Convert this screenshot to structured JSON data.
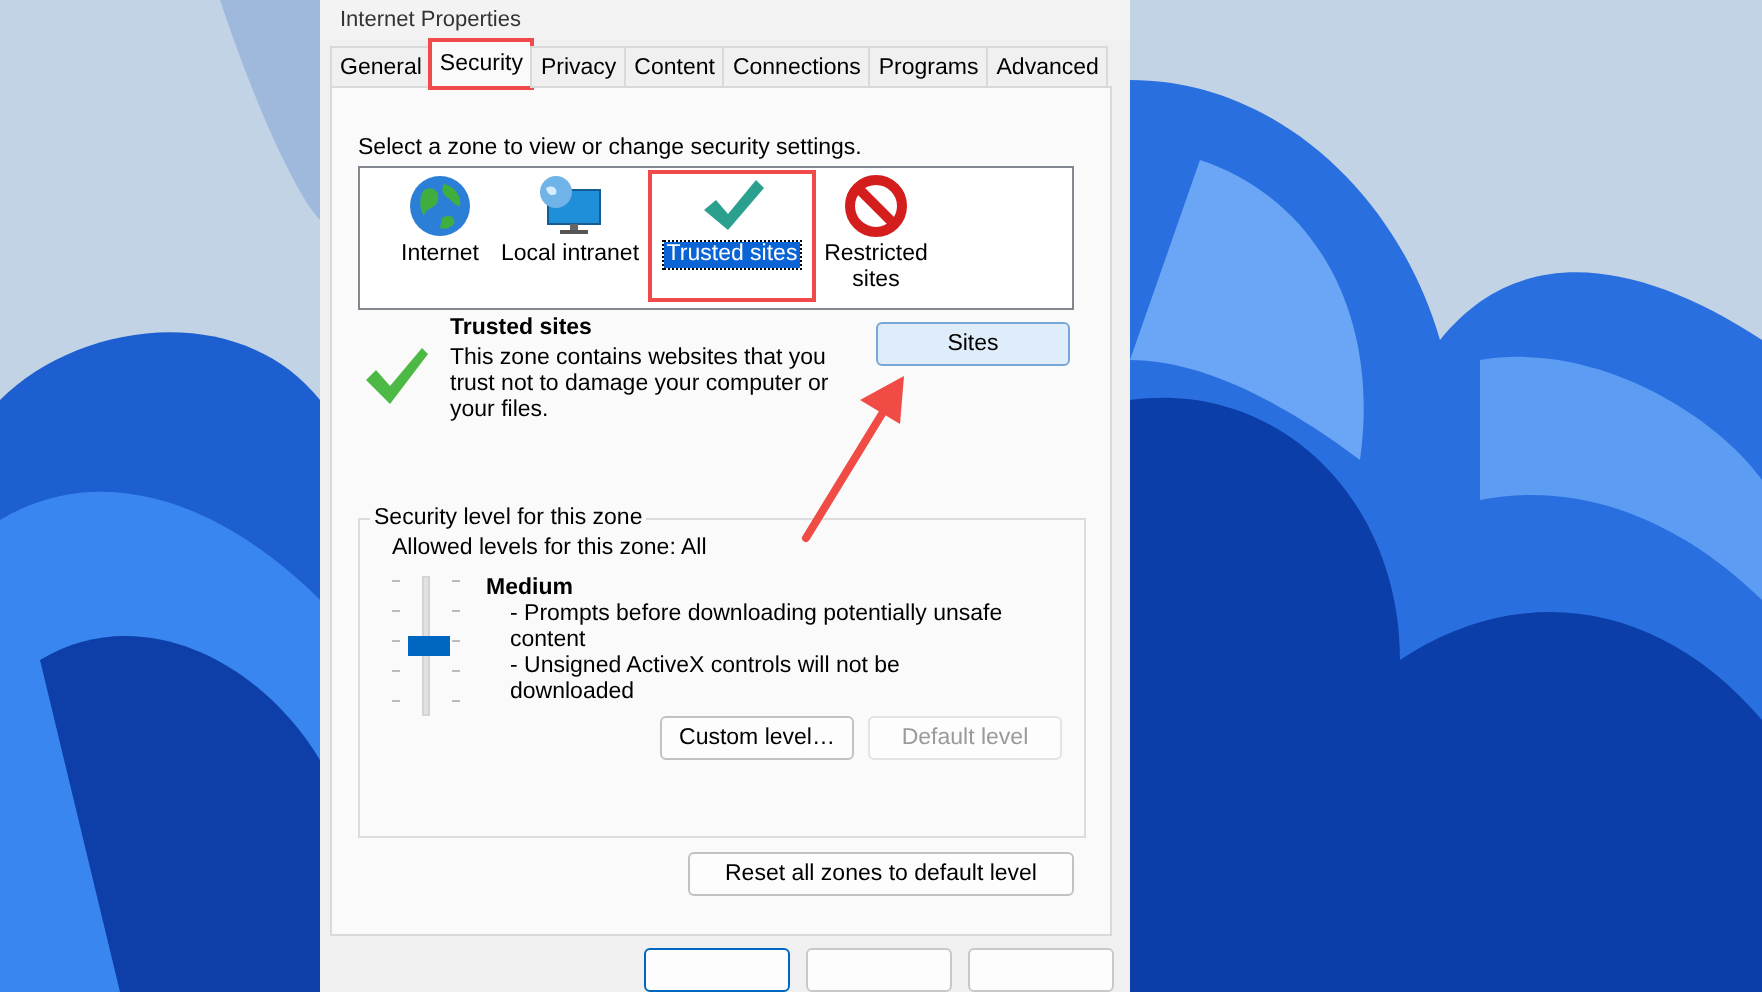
{
  "window": {
    "title": "Internet Properties"
  },
  "tabs": [
    {
      "label": "General",
      "selected": false,
      "highlighted": false
    },
    {
      "label": "Security",
      "selected": true,
      "highlighted": true
    },
    {
      "label": "Privacy",
      "selected": false,
      "highlighted": false
    },
    {
      "label": "Content",
      "selected": false,
      "highlighted": false
    },
    {
      "label": "Connections",
      "selected": false,
      "highlighted": false
    },
    {
      "label": "Programs",
      "selected": false,
      "highlighted": false
    },
    {
      "label": "Advanced",
      "selected": false,
      "highlighted": false
    }
  ],
  "zone_prompt": "Select a zone to view or change security settings.",
  "zones": [
    {
      "label": "Internet",
      "kind": "globe",
      "selected": false,
      "highlighted": false
    },
    {
      "label": "Local intranet",
      "kind": "monitor",
      "selected": false,
      "highlighted": false
    },
    {
      "label": "Trusted sites",
      "kind": "check",
      "selected": true,
      "highlighted": true
    },
    {
      "label": "Restricted sites",
      "kind": "blocked",
      "selected": false,
      "highlighted": false
    }
  ],
  "zone_detail": {
    "title": "Trusted sites",
    "description": "This zone contains websites that you trust not to damage your computer or your files.",
    "button": "Sites",
    "arrow_to_button": true
  },
  "security_level": {
    "legend": "Security level for this zone",
    "allowed": "Allowed levels for this zone: All",
    "slider": {
      "level": 0.5
    },
    "level_name": "Medium",
    "bullets": [
      "- Prompts before downloading potentially unsafe content",
      "- Unsigned ActiveX controls will not be downloaded"
    ],
    "buttons": [
      {
        "label": "Custom level…",
        "disabled": false
      },
      {
        "label": "Default level",
        "disabled": true
      }
    ]
  },
  "reset_button": "Reset all zones to default level"
}
